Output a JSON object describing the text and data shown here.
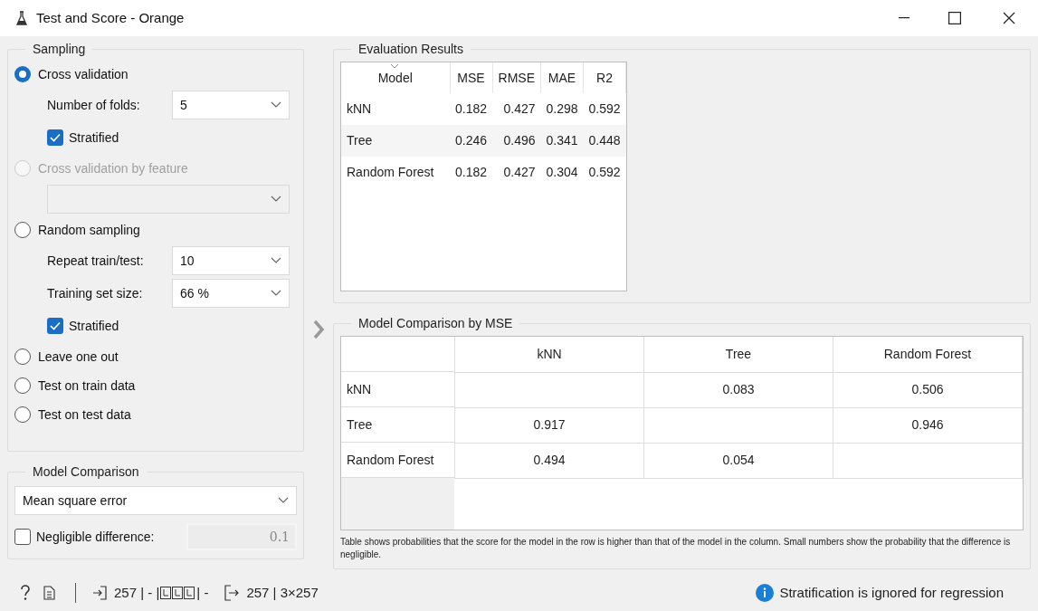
{
  "window": {
    "title": "Test and Score - Orange"
  },
  "sampling": {
    "title": "Sampling",
    "options": [
      {
        "label": "Cross validation",
        "selected": true,
        "disabled": false,
        "settings": [
          {
            "kind": "select",
            "label": "Number of folds:",
            "value": "5",
            "disabled": false
          },
          {
            "kind": "checkbox",
            "label": "Stratified",
            "checked": true
          }
        ]
      },
      {
        "label": "Cross validation by feature",
        "selected": false,
        "disabled": true,
        "settings": [
          {
            "kind": "select",
            "disabled": true
          }
        ]
      },
      {
        "label": "Random sampling",
        "selected": false,
        "disabled": false,
        "settings": [
          {
            "kind": "select",
            "label": "Repeat train/test:",
            "value": "10",
            "disabled": false
          },
          {
            "kind": "select",
            "label": "Training set size:",
            "value": "66 %",
            "disabled": false
          },
          {
            "kind": "checkbox",
            "label": "Stratified",
            "checked": true
          }
        ]
      },
      {
        "label": "Leave one out",
        "selected": false,
        "disabled": false
      },
      {
        "label": "Test on train data",
        "selected": false,
        "disabled": false
      },
      {
        "label": "Test on test data",
        "selected": false,
        "disabled": false
      }
    ]
  },
  "model_comparison": {
    "title": "Model Comparison",
    "score": "Mean square error",
    "negligible": {
      "label": "Negligible difference:",
      "checked": false,
      "value": "0.1"
    }
  },
  "evaluation": {
    "title": "Evaluation Results",
    "columns": [
      "Model",
      "MSE",
      "RMSE",
      "MAE",
      "R2"
    ],
    "rows": [
      [
        "kNN",
        "0.182",
        "0.427",
        "0.298",
        "0.592"
      ],
      [
        "Tree",
        "0.246",
        "0.496",
        "0.341",
        "0.448"
      ],
      [
        "Random Forest",
        "0.182",
        "0.427",
        "0.304",
        "0.592"
      ]
    ]
  },
  "comparison": {
    "title": "Model Comparison by MSE",
    "columns": [
      "kNN",
      "Tree",
      "Random Forest"
    ],
    "rows": [
      {
        "name": "kNN",
        "cells": [
          null,
          "0.083",
          "0.506"
        ]
      },
      {
        "name": "Tree",
        "cells": [
          "0.917",
          null,
          "0.946"
        ]
      },
      {
        "name": "Random Forest",
        "cells": [
          "0.494",
          "0.054",
          null
        ]
      }
    ],
    "note": "Table shows probabilities that the score for the model in the row is higher than that of the model in the column. Small numbers show the probability that the difference is negligible."
  },
  "status_bar": {
    "input": "257 | - |",
    "input_tail": "| -",
    "output": "257 | 3×257",
    "message": "Stratification is ignored for regression"
  }
}
